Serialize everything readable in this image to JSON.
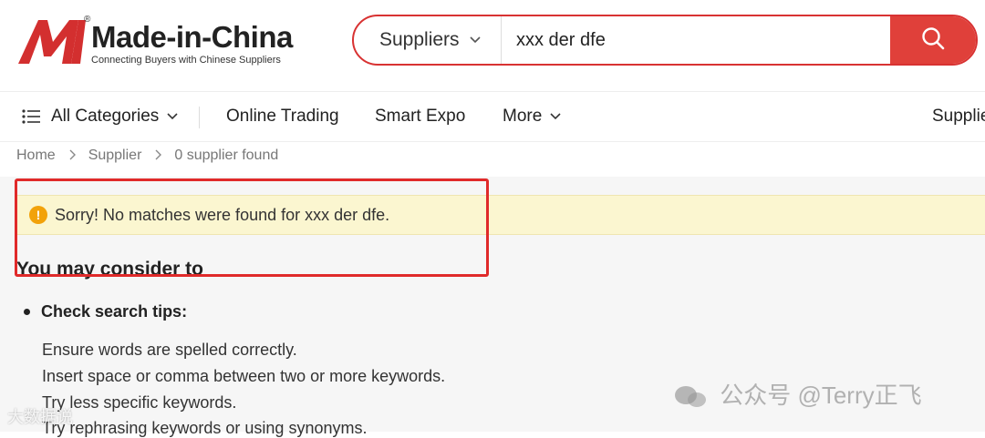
{
  "header": {
    "logo_name": "Made-in-China",
    "logo_tagline": "Connecting Buyers with Chinese Suppliers",
    "logo_reg": "®",
    "logo_color": "#d32f2f"
  },
  "search": {
    "type_label": "Suppliers",
    "query": "xxx der dfe",
    "button_icon": "search-icon",
    "accent": "#e0403a"
  },
  "nav": {
    "all_categories": "All Categories",
    "online_trading": "Online Trading",
    "smart_expo": "Smart Expo",
    "more": "More",
    "suppliers_cut": "Supplie"
  },
  "breadcrumb": [
    "Home",
    "Supplier",
    "0 supplier found"
  ],
  "alert": {
    "text": "Sorry! No matches were found for xxx der dfe.",
    "icon": "!"
  },
  "suggestions": {
    "heading": "You may consider to",
    "tips_title": "Check search tips:",
    "tips": [
      "Ensure words are spelled correctly.",
      "Insert space or comma between two or more keywords.",
      "Try less specific keywords.",
      "Try rephrasing keywords or using synonyms."
    ]
  },
  "watermarks": {
    "right": "公众号 @Terry正飞",
    "left": "大数据说"
  }
}
